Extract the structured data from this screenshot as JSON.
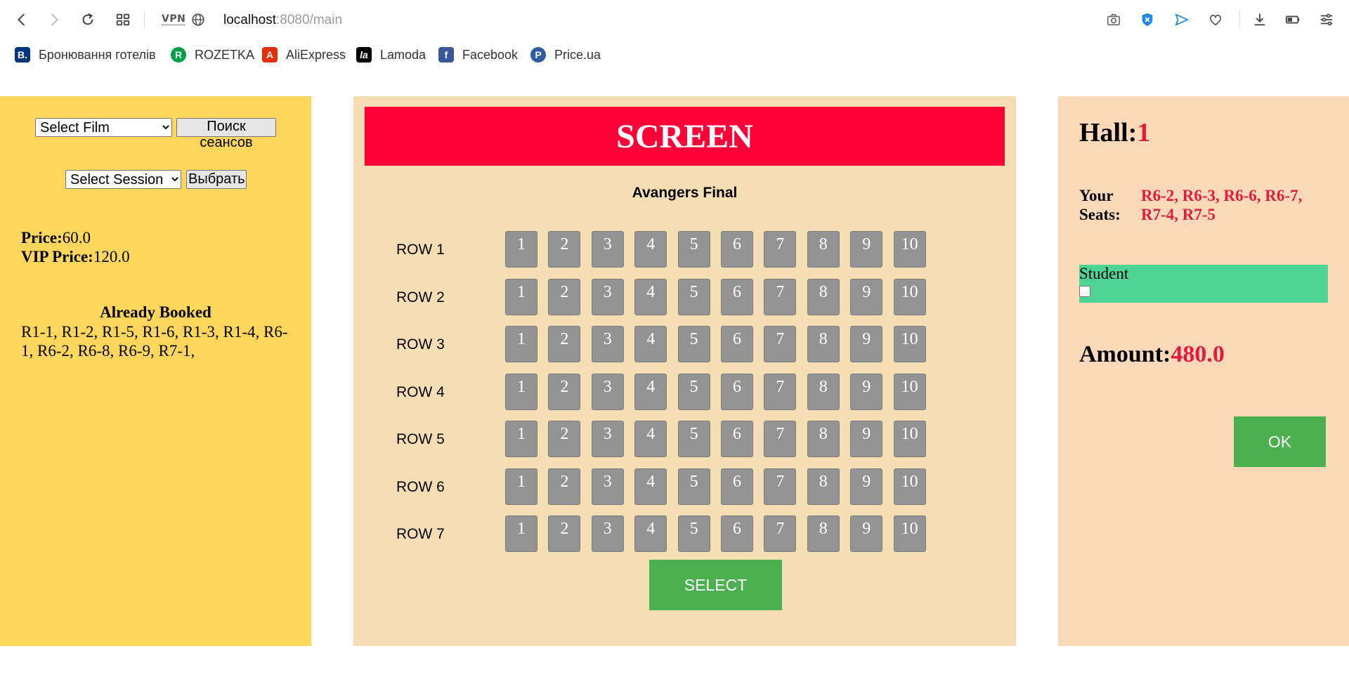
{
  "browser": {
    "vpn_label": "VPN",
    "url_host": "localhost",
    "url_rest": ":8080/main",
    "bookmarks": [
      {
        "label": "Бронювання готелів",
        "icon": "B.",
        "color": "#003580"
      },
      {
        "label": "ROZETKA",
        "icon": "R",
        "color": "#00A046"
      },
      {
        "label": "AliExpress",
        "icon": "A",
        "color": "#E62E04"
      },
      {
        "label": "Lamoda",
        "icon": "la",
        "color": "#000000"
      },
      {
        "label": "Facebook",
        "icon": "f",
        "color": "#3B5998"
      },
      {
        "label": "Price.ua",
        "icon": "P",
        "color": "#2D5D9F"
      }
    ]
  },
  "left": {
    "film_select": "Select Film",
    "search_button": "Поиск сеансов",
    "session_select": "Select Session",
    "choose_button": "Выбрать",
    "price_label": "Price:",
    "price_value": "60.0",
    "vip_label": "VIP Price:",
    "vip_value": "120.0",
    "booked_title": "Already Booked",
    "booked_list": "R1-1, R1-2, R1-5, R1-6, R1-3, R1-4, R6-1, R6-2, R6-8, R6-9, R7-1,"
  },
  "center": {
    "screen_label": "SCREEN",
    "film_name": "Avangers Final",
    "rows": [
      "ROW 1",
      "ROW 2",
      "ROW 3",
      "ROW 4",
      "ROW 5",
      "ROW 6",
      "ROW 7"
    ],
    "seats": [
      "1",
      "2",
      "3",
      "4",
      "5",
      "6",
      "7",
      "8",
      "9",
      "10"
    ],
    "select_button": "SELECT"
  },
  "right": {
    "hall_label": "Hall:",
    "hall_value": "1",
    "your_seats_label": "Your Seats:",
    "your_seats_value": "R6-2, R6-3, R6-6, R6-7, R7-4, R7-5",
    "student_label": "Student",
    "amount_label": "Amount:",
    "amount_value": "480.0",
    "ok_button": "OK"
  },
  "colors": {
    "left_bg": "#FFD65C",
    "center_bg": "#F5DEB3",
    "right_bg": "#FCD9B8",
    "screen_red": "#FF0038",
    "accent_red": "#E31B3C",
    "button_green": "#4CAF50",
    "student_green": "#4ED495",
    "seat_grey": "#939393"
  }
}
